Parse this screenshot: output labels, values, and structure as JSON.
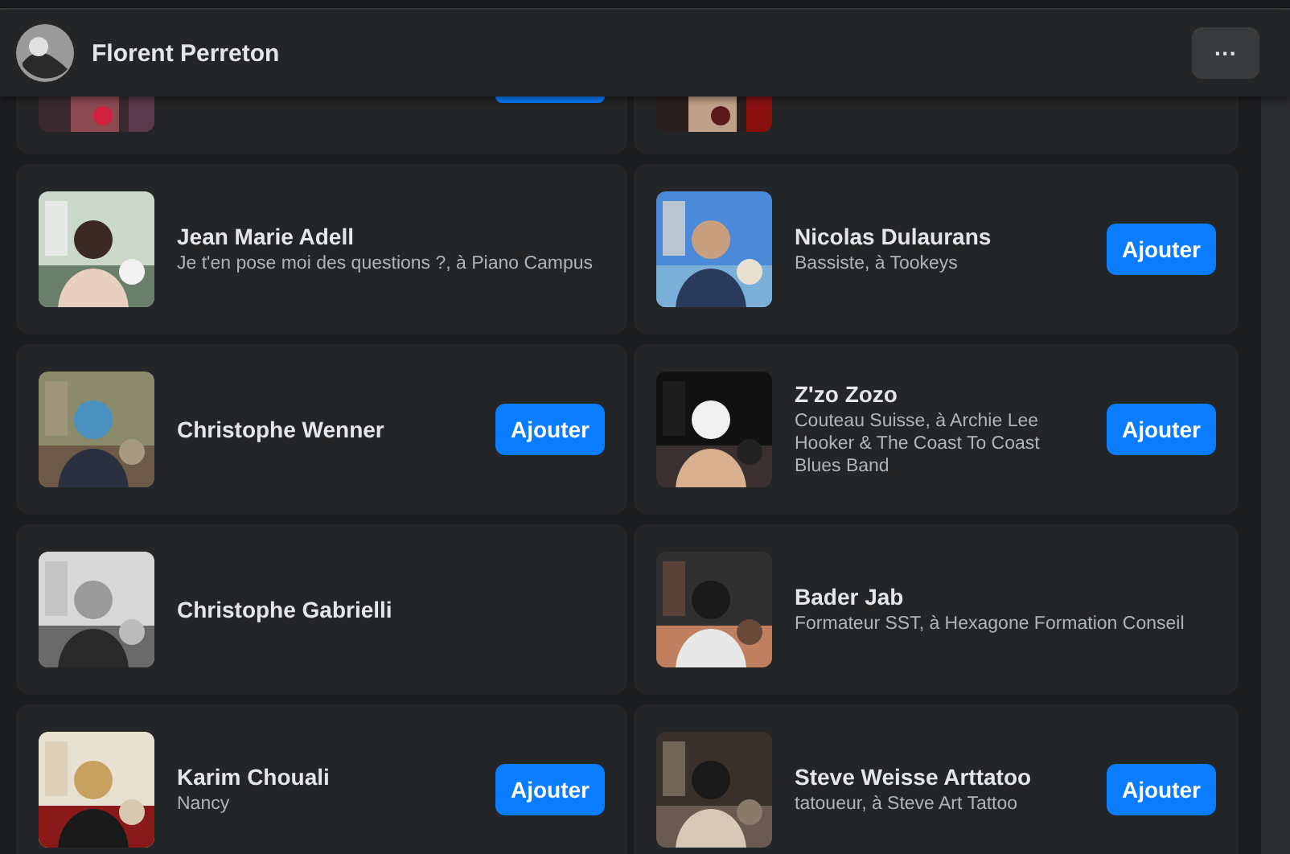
{
  "header": {
    "name": "Florent Perreton",
    "more_button": "···"
  },
  "clipped_row": [
    {
      "has_button": true
    },
    {
      "has_button": false
    }
  ],
  "friends": [
    {
      "name": "Jean Marie Adell",
      "subtitle": "Je t'en pose moi des questions ?, à Piano Campus"
    },
    {
      "name": "Christophe Wenner",
      "button": "Ajouter"
    },
    {
      "name": "Christophe Gabrielli"
    },
    {
      "name": "Karim Chouali",
      "subtitle": "Nancy",
      "button": "Ajouter"
    },
    {
      "name": "Nicolas Dulaurans",
      "subtitle": "Bassiste, à Tookeys",
      "button": "Ajouter"
    },
    {
      "name": "Z'zo Zozo",
      "subtitle": "Couteau Suisse, à Archie Lee Hooker & The Coast To Coast Blues Band",
      "button": "Ajouter"
    },
    {
      "name": "Bader Jab",
      "subtitle": "Formateur SST, à Hexagone Formation Conseil"
    },
    {
      "name": "Steve Weisse Arttatoo",
      "subtitle": "tatoueur, à Steve Art Tattoo",
      "button": "Ajouter"
    }
  ]
}
